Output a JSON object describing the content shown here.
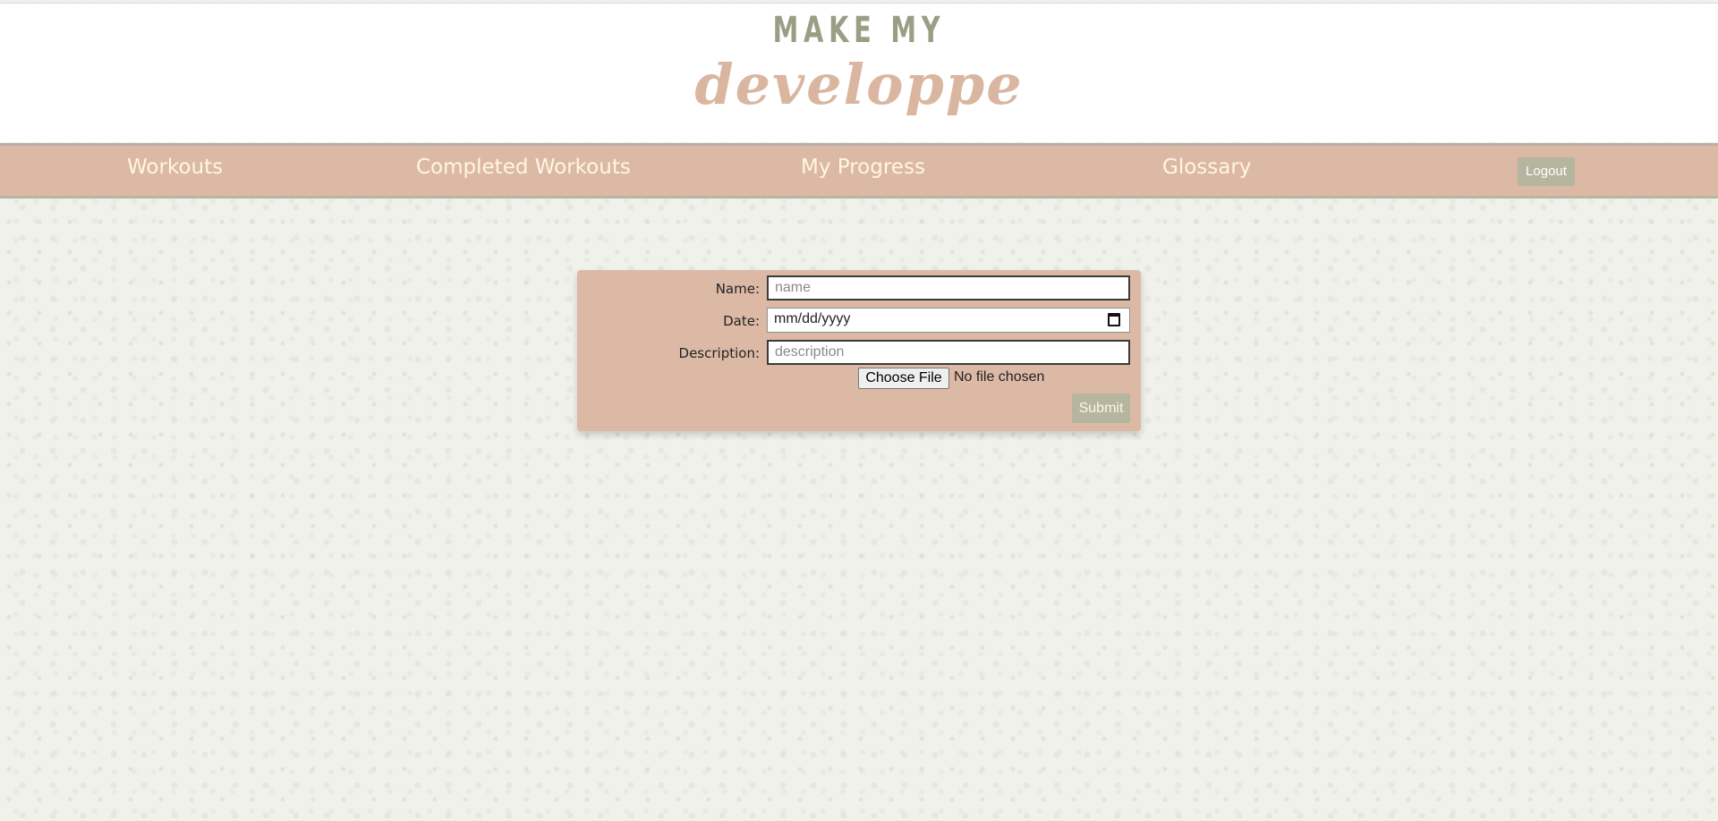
{
  "logo": {
    "line1": "MAKE MY",
    "line2": "developpe"
  },
  "nav": {
    "items": [
      {
        "label": "Workouts"
      },
      {
        "label": "Completed Workouts"
      },
      {
        "label": "My Progress"
      },
      {
        "label": "Glossary"
      }
    ],
    "logout_label": "Logout"
  },
  "form": {
    "name_label": "Name:",
    "name_placeholder": "name",
    "date_label": "Date:",
    "date_value": "mm/dd/yyyy",
    "description_label": "Description:",
    "description_placeholder": "description",
    "file_button_label": "Choose File",
    "file_status": "No file chosen",
    "submit_label": "Submit"
  },
  "colors": {
    "nav_background": "#dcb9a5",
    "nav_text": "#fff6e4",
    "button_background": "#b6b59f",
    "logo_sage": "#9b9e85",
    "logo_blush": "#dab6a0"
  }
}
